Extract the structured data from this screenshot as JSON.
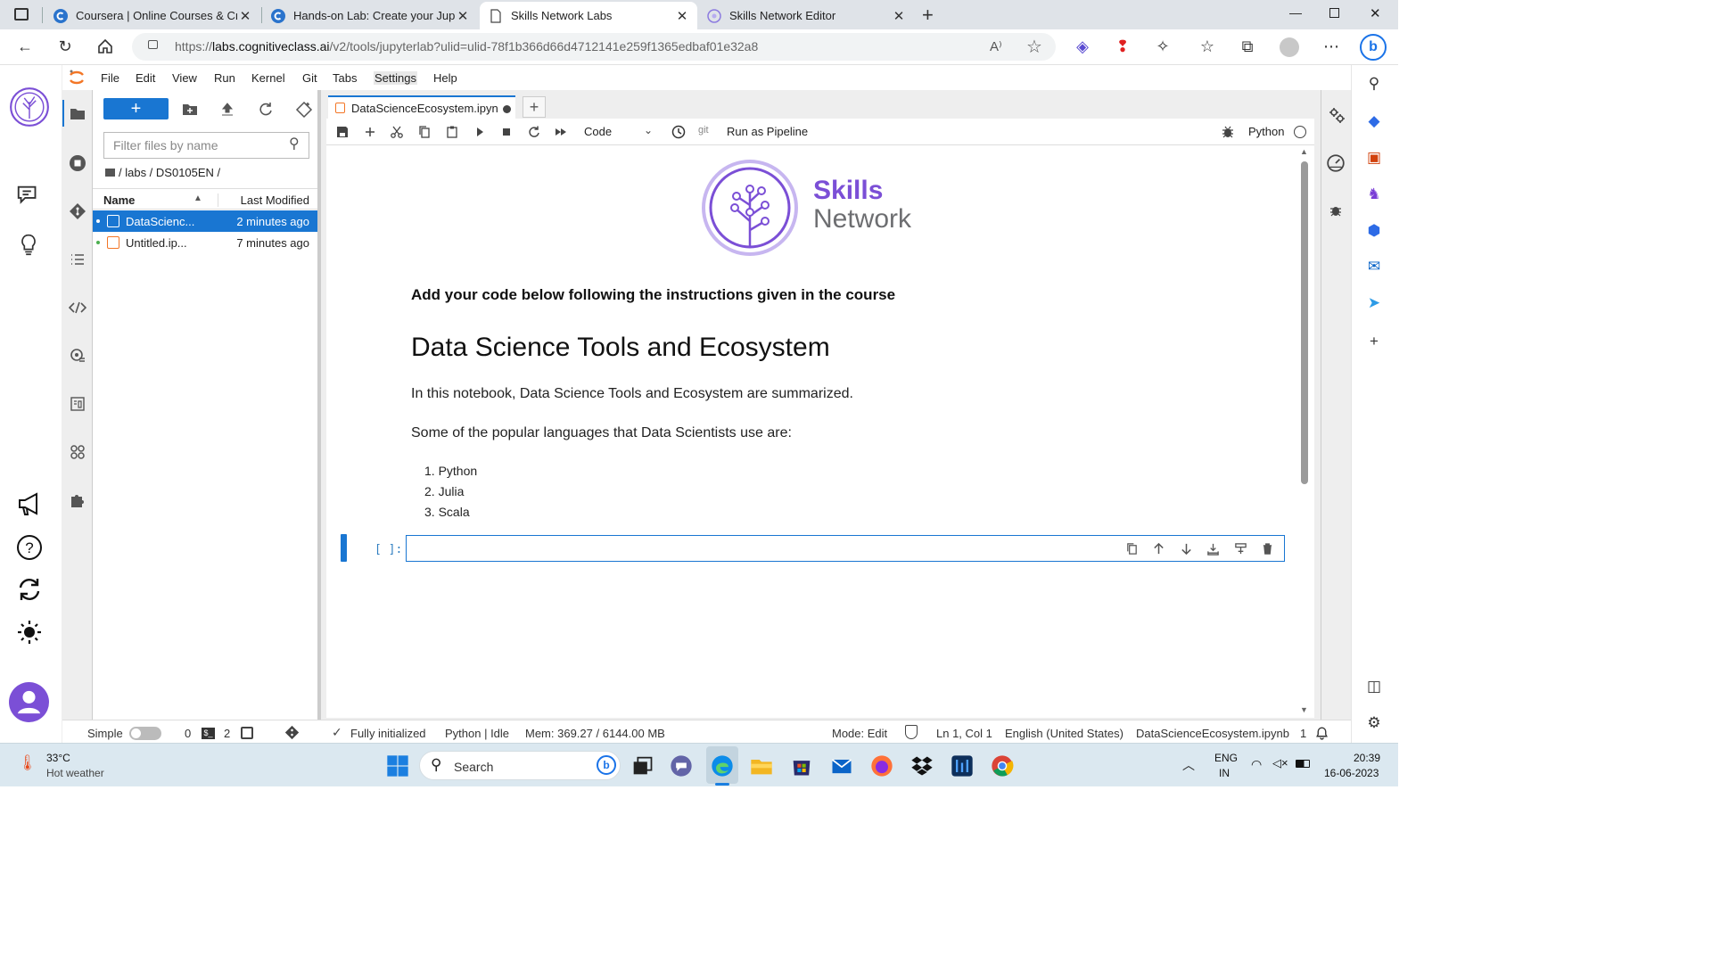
{
  "browser": {
    "tabs": [
      {
        "title": "Coursera | Online Courses & Cre"
      },
      {
        "title": "Hands-on Lab: Create your Jupyt"
      },
      {
        "title": "Skills Network Labs"
      },
      {
        "title": "Skills Network Editor"
      }
    ],
    "url_prefix": "https://",
    "url_domain": "labs.cognitiveclass.ai",
    "url_path": "/v2/tools/jupyterlab?ulid=ulid-78f1b366d66d4712141e259f1365edbaf01e32a8"
  },
  "menu": [
    "File",
    "Edit",
    "View",
    "Run",
    "Kernel",
    "Git",
    "Tabs",
    "Settings",
    "Help"
  ],
  "filebrowser": {
    "new_label": "+",
    "filter_placeholder": "Filter files by name",
    "breadcrumb": "/ labs / DS0105EN /",
    "col_name": "Name",
    "col_modified": "Last Modified",
    "files": [
      {
        "name": "DataScienc...",
        "modified": "2 minutes ago"
      },
      {
        "name": "Untitled.ip...",
        "modified": "7 minutes ago"
      }
    ]
  },
  "notebook": {
    "tab_title": "DataScienceEcosystem.ipyn",
    "cell_type": "Code",
    "run_pipeline": "Run as Pipeline",
    "git_label": "git",
    "kernel": "Python",
    "logo_line1": "Skills",
    "logo_line2": "Network",
    "instruction": "Add your code below following the instructions given in the course",
    "heading": "Data Science Tools and Ecosystem",
    "summary": "In this notebook, Data Science Tools and Ecosystem are summarized.",
    "languages_intro": "Some of the popular languages that Data Scientists use are:",
    "languages": [
      "Python",
      "Julia",
      "Scala"
    ],
    "prompt": "[ ]:"
  },
  "status": {
    "simple": "Simple",
    "kernels": "0",
    "terminals": "2",
    "init": "Fully initialized",
    "kernel_state": "Python | Idle",
    "mem": "Mem: 369.27 / 6144.00 MB",
    "mode": "Mode: Edit",
    "pos": "Ln 1, Col 1",
    "lang": "English (United States)",
    "file": "DataScienceEcosystem.ipynb",
    "notifications": "1"
  },
  "taskbar": {
    "temp": "33°C",
    "weather": "Hot weather",
    "search": "Search",
    "lang1": "ENG",
    "lang2": "IN",
    "time": "20:39",
    "date": "16-06-2023"
  },
  "colors": {
    "accent": "#1976d2",
    "brand_purple": "#7b4fd6",
    "brand_gray": "#6d6e71"
  }
}
